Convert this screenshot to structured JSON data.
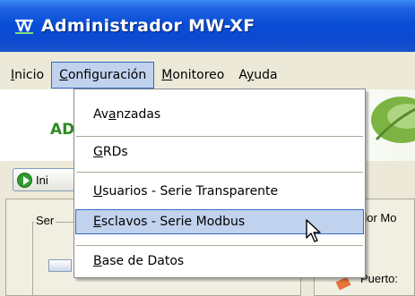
{
  "window": {
    "title": "Administrador MW-XF",
    "icon": "app-logo-icon"
  },
  "menubar": {
    "items": [
      {
        "label": "Inicio",
        "underline": "I"
      },
      {
        "label": "Configuración",
        "underline": "C",
        "active": true
      },
      {
        "label": "Monitoreo",
        "underline": "M"
      },
      {
        "label": "Ayuda",
        "underline": "y"
      }
    ]
  },
  "dropdown": {
    "items": [
      {
        "pre": "Av",
        "ul": "a",
        "post": "nzadas"
      },
      {
        "pre": "",
        "ul": "G",
        "post": "RDs"
      },
      {
        "pre": "",
        "ul": "U",
        "post": "suarios - Serie Transparente"
      },
      {
        "pre": "",
        "ul": "E",
        "post": "sclavos - Serie Modbus",
        "highlighted": true
      },
      {
        "pre": "",
        "ul": "B",
        "post": "ase de Datos"
      }
    ]
  },
  "background": {
    "banner_text": "AD",
    "start_button": "Ini",
    "left_group_label": "Ser",
    "right_label_1": "dor Mo",
    "right_label_2": "Puerto:"
  },
  "colors": {
    "title_bar": "#0a4fd8",
    "menu_highlight": "#c1d2ee",
    "menu_highlight_border": "#316ac5",
    "banner_text": "#2e8b22"
  }
}
